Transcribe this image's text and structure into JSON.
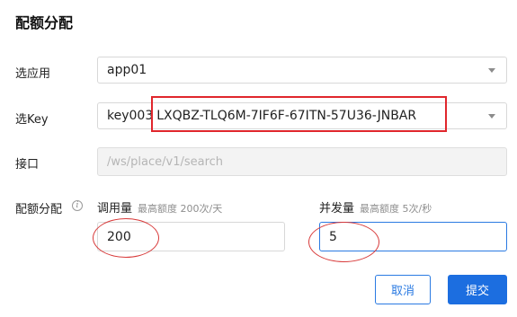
{
  "dialog": {
    "title": "配额分配"
  },
  "app_field": {
    "label": "选应用",
    "value": "app01"
  },
  "key_field": {
    "label": "选Key",
    "prefix": "key003",
    "value": "LXQBZ-TLQ6M-7IF6F-67ITN-57U36-JNBAR"
  },
  "api_field": {
    "label": "接口",
    "placeholder": "/ws/place/v1/search"
  },
  "quota": {
    "label": "配额分配",
    "calls": {
      "label": "调用量",
      "hint": "最高额度 200次/天",
      "value": "200"
    },
    "concurrency": {
      "label": "并发量",
      "hint": "最高额度 5次/秒",
      "value": "5"
    }
  },
  "buttons": {
    "cancel": "取消",
    "submit": "提交"
  },
  "colors": {
    "primary": "#1c6ee0",
    "annotation": "#e0262c"
  },
  "icons": {
    "dropdown": "chevron-down-icon",
    "info": "info-circle-icon"
  }
}
